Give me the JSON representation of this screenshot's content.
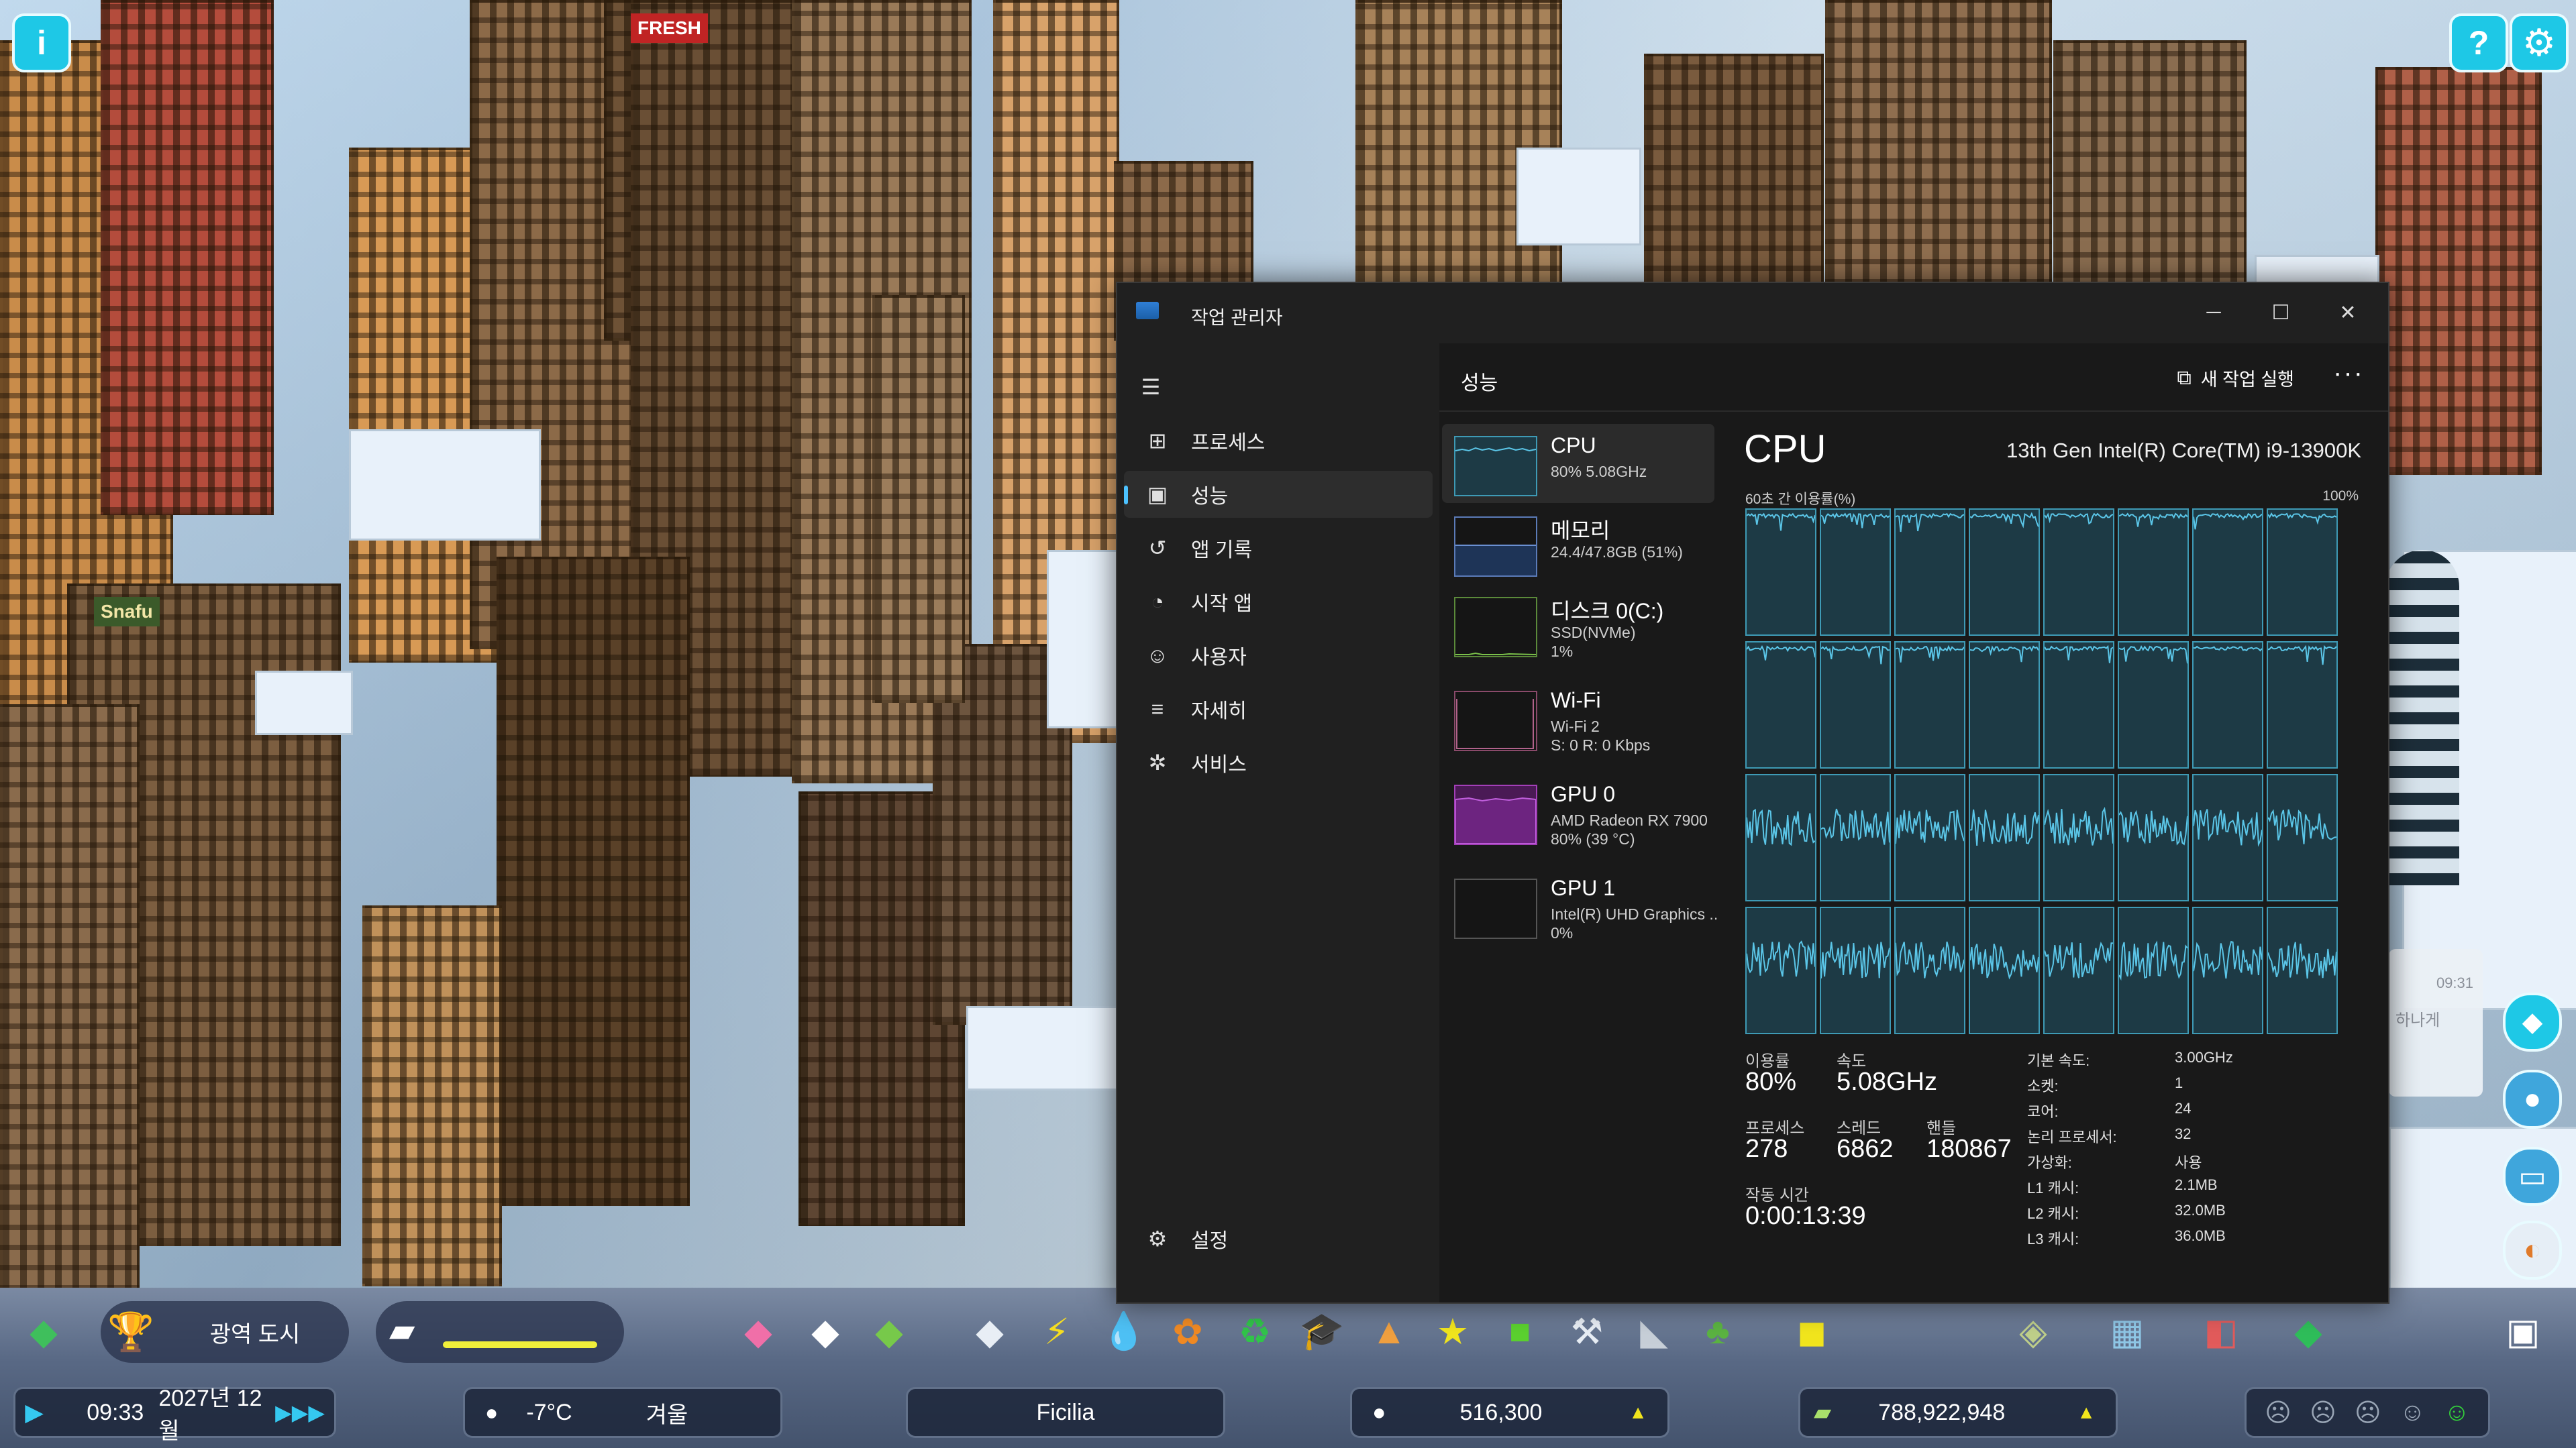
{
  "game": {
    "hud": {
      "milestone": "광역 도시",
      "time": "09:33",
      "date": "2027년 12월",
      "temperature": "-7°C",
      "season": "겨울",
      "city_name": "Ficilia",
      "population": "516,300",
      "money": "788,922,948",
      "bubble_time": "09:31",
      "bubble_text": "하나게"
    },
    "signs": {
      "snafu": "Snafu",
      "fresh": "FRESH"
    }
  },
  "task_manager": {
    "window_title": "작업 관리자",
    "window_controls": [
      "─",
      "☐",
      "✕"
    ],
    "nav": [
      {
        "label": "프로세스",
        "icon": "processes-icon"
      },
      {
        "label": "성능",
        "icon": "performance-icon"
      },
      {
        "label": "앱 기록",
        "icon": "app-history-icon"
      },
      {
        "label": "시작 앱",
        "icon": "startup-apps-icon"
      },
      {
        "label": "사용자",
        "icon": "users-icon"
      },
      {
        "label": "자세히",
        "icon": "details-icon"
      },
      {
        "label": "서비스",
        "icon": "services-icon"
      }
    ],
    "settings_label": "설정",
    "header": {
      "page_title": "성능",
      "run_new_task": "새 작업 실행",
      "more": "···"
    },
    "devices": [
      {
        "name": "CPU",
        "sub1": "80% 5.08GHz",
        "sub2": ""
      },
      {
        "name": "메모리",
        "sub1": "24.4/47.8GB (51%)",
        "sub2": ""
      },
      {
        "name": "디스크 0(C:)",
        "sub1": "SSD(NVMe)",
        "sub2": "1%"
      },
      {
        "name": "Wi-Fi",
        "sub1": "Wi-Fi 2",
        "sub2": "S: 0 R: 0 Kbps"
      },
      {
        "name": "GPU 0",
        "sub1": "AMD Radeon RX 7900",
        "sub2": "80% (39 °C)"
      },
      {
        "name": "GPU 1",
        "sub1": "Intel(R) UHD Graphics ..",
        "sub2": "0%"
      }
    ],
    "cpu": {
      "title": "CPU",
      "model": "13th Gen Intel(R) Core(TM) i9-13900K",
      "graph_label": "60초 간 이용률(%)",
      "graph_max": "100%",
      "stats": {
        "utilization_label": "이용률",
        "utilization": "80%",
        "speed_label": "속도",
        "speed": "5.08GHz",
        "processes_label": "프로세스",
        "processes": "278",
        "threads_label": "스레드",
        "threads": "6862",
        "handles_label": "핸들",
        "handles": "180867",
        "uptime_label": "작동 시간",
        "uptime": "0:00:13:39"
      },
      "specs": [
        {
          "k": "기본 속도:",
          "v": "3.00GHz"
        },
        {
          "k": "소켓:",
          "v": "1"
        },
        {
          "k": "코어:",
          "v": "24"
        },
        {
          "k": "논리 프로세서:",
          "v": "32"
        },
        {
          "k": "가상화:",
          "v": "사용"
        },
        {
          "k": "L1 캐시:",
          "v": "2.1MB"
        },
        {
          "k": "L2 캐시:",
          "v": "32.0MB"
        },
        {
          "k": "L3 캐시:",
          "v": "36.0MB"
        }
      ]
    }
  }
}
